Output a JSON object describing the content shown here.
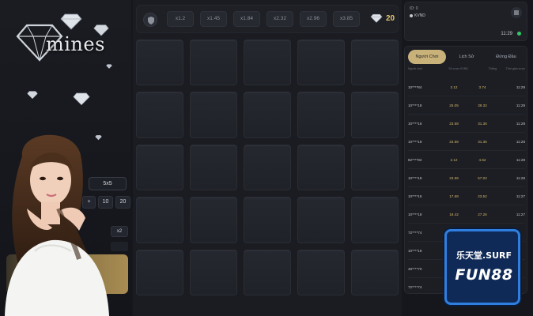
{
  "logo": {
    "text": "mines"
  },
  "controls": {
    "grid_size": "5x5",
    "quantity_buttons": [
      "+",
      "10",
      "20"
    ],
    "multiplier_button": "x2"
  },
  "top_bar": {
    "multipliers": [
      "x1.2",
      "x1.45",
      "x1.84",
      "x2.32",
      "x2.96",
      "x3.85"
    ],
    "gem_count": "20"
  },
  "account": {
    "id_label": "ID: 0",
    "username": "KVND",
    "time": "11:29"
  },
  "history": {
    "tabs": [
      "Người Chơi",
      "Lịch Sử",
      "Đứng Đầu"
    ],
    "active_tab": 0,
    "columns": [
      "Người chơi",
      "Số cược KVND",
      "Thắng",
      "Thời gian cược"
    ],
    "rows": [
      [
        "10****84",
        "2.12",
        "3.74",
        "11:29"
      ],
      [
        "10****18",
        "25.05",
        "39.32",
        "11:29"
      ],
      [
        "10****16",
        "23.58",
        "31.36",
        "11:28"
      ],
      [
        "10****18",
        "23.58",
        "31.36",
        "11:28"
      ],
      [
        "82****92",
        "2.12",
        "4.52",
        "11:28"
      ],
      [
        "10****18",
        "23.58",
        "57.02",
        "11:28"
      ],
      [
        "10****16",
        "17.68",
        "23.52",
        "11:27"
      ],
      [
        "10****18",
        "18.42",
        "27.26",
        "11:27"
      ],
      [
        "72****74",
        "",
        "",
        ""
      ],
      [
        "10****18",
        "",
        "",
        ""
      ],
      [
        "48****70",
        "",
        "",
        ""
      ],
      [
        "72****74",
        "",
        "",
        ""
      ]
    ]
  },
  "brand": {
    "top": "乐天堂.SURF",
    "bottom": "FUN88"
  },
  "colors": {
    "gold": "#e3c470",
    "tab_active": "#c9b27a",
    "online": "#33c96b",
    "brand_blue": "#2f7fe0"
  }
}
